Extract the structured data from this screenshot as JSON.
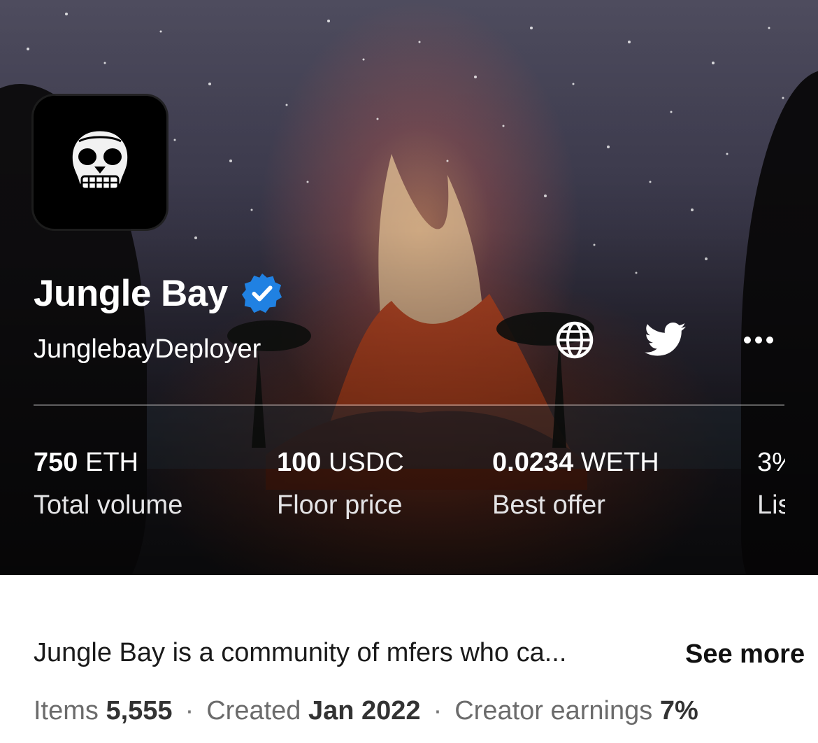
{
  "collection": {
    "name": "Jungle Bay",
    "handle": "JunglebayDeployer"
  },
  "icons": {
    "avatar": "skull-logo",
    "verified": "verified-badge-icon",
    "website": "globe-icon",
    "twitter": "twitter-bird-icon",
    "more": "more-dots-icon"
  },
  "stats": [
    {
      "value": "750",
      "unit": "ETH",
      "label": "Total volume"
    },
    {
      "value": "100",
      "unit": "USDC",
      "label": "Floor price"
    },
    {
      "value": "0.0234",
      "unit": "WETH",
      "label": "Best offer"
    },
    {
      "value": "3%",
      "unit": "",
      "label": "Listed"
    }
  ],
  "description": {
    "text": "Jungle Bay is a community of mfers who ca...",
    "see_more": "See more"
  },
  "meta": {
    "items_label": "Items",
    "items_value": "5,555",
    "created_label": "Created",
    "created_value": "Jan 2022",
    "earnings_label": "Creator earnings",
    "earnings_value": "7%"
  },
  "colors": {
    "verified": "#2081e2",
    "text_primary": "#1a1a1a",
    "text_secondary": "#6b6b6b"
  }
}
